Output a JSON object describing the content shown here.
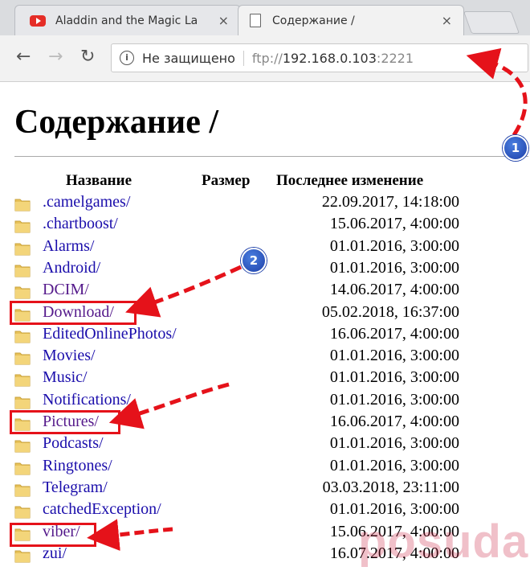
{
  "browser": {
    "tabs": [
      {
        "title": "Aladdin and the Magic La",
        "icon": "youtube-icon",
        "active": false
      },
      {
        "title": "Содержание /",
        "icon": "page-icon",
        "active": true
      }
    ],
    "close_glyph": "×",
    "security_text": "Не защищено",
    "url": {
      "scheme": "ftp://",
      "host": "192.168.0.103",
      "port": ":2221"
    }
  },
  "page": {
    "heading": "Содержание /",
    "columns": {
      "name": "Название",
      "size": "Размер",
      "modified": "Последнее изменение"
    },
    "items": [
      {
        "name": ".camelgames/",
        "modified": "22.09.2017, 14:18:00",
        "visited": false
      },
      {
        "name": ".chartboost/",
        "modified": "15.06.2017, 4:00:00",
        "visited": false
      },
      {
        "name": "Alarms/",
        "modified": "01.01.2016, 3:00:00",
        "visited": false
      },
      {
        "name": "Android/",
        "modified": "01.01.2016, 3:00:00",
        "visited": false
      },
      {
        "name": "DCIM/",
        "modified": "14.06.2017, 4:00:00",
        "visited": true
      },
      {
        "name": "Download/",
        "modified": "05.02.2018, 16:37:00",
        "visited": true
      },
      {
        "name": "EditedOnlinePhotos/",
        "modified": "16.06.2017, 4:00:00",
        "visited": false
      },
      {
        "name": "Movies/",
        "modified": "01.01.2016, 3:00:00",
        "visited": false
      },
      {
        "name": "Music/",
        "modified": "01.01.2016, 3:00:00",
        "visited": false
      },
      {
        "name": "Notifications/",
        "modified": "01.01.2016, 3:00:00",
        "visited": false
      },
      {
        "name": "Pictures/",
        "modified": "16.06.2017, 4:00:00",
        "visited": true
      },
      {
        "name": "Podcasts/",
        "modified": "01.01.2016, 3:00:00",
        "visited": false
      },
      {
        "name": "Ringtones/",
        "modified": "01.01.2016, 3:00:00",
        "visited": false
      },
      {
        "name": "Telegram/",
        "modified": "03.03.2018, 23:11:00",
        "visited": false
      },
      {
        "name": "catchedException/",
        "modified": "01.01.2016, 3:00:00",
        "visited": false
      },
      {
        "name": "viber/",
        "modified": "15.06.2017, 4:00:00",
        "visited": true
      },
      {
        "name": "zui/",
        "modified": "16.07.2017, 4:00:00",
        "visited": false
      }
    ]
  },
  "annotations": {
    "badge_1": "1",
    "badge_2": "2",
    "watermark": "posuda.ru"
  },
  "colors": {
    "link": "#1a0dab",
    "visited": "#551a8b",
    "annotation_red": "#e5121a",
    "badge_blue": "#1d3fa8"
  }
}
